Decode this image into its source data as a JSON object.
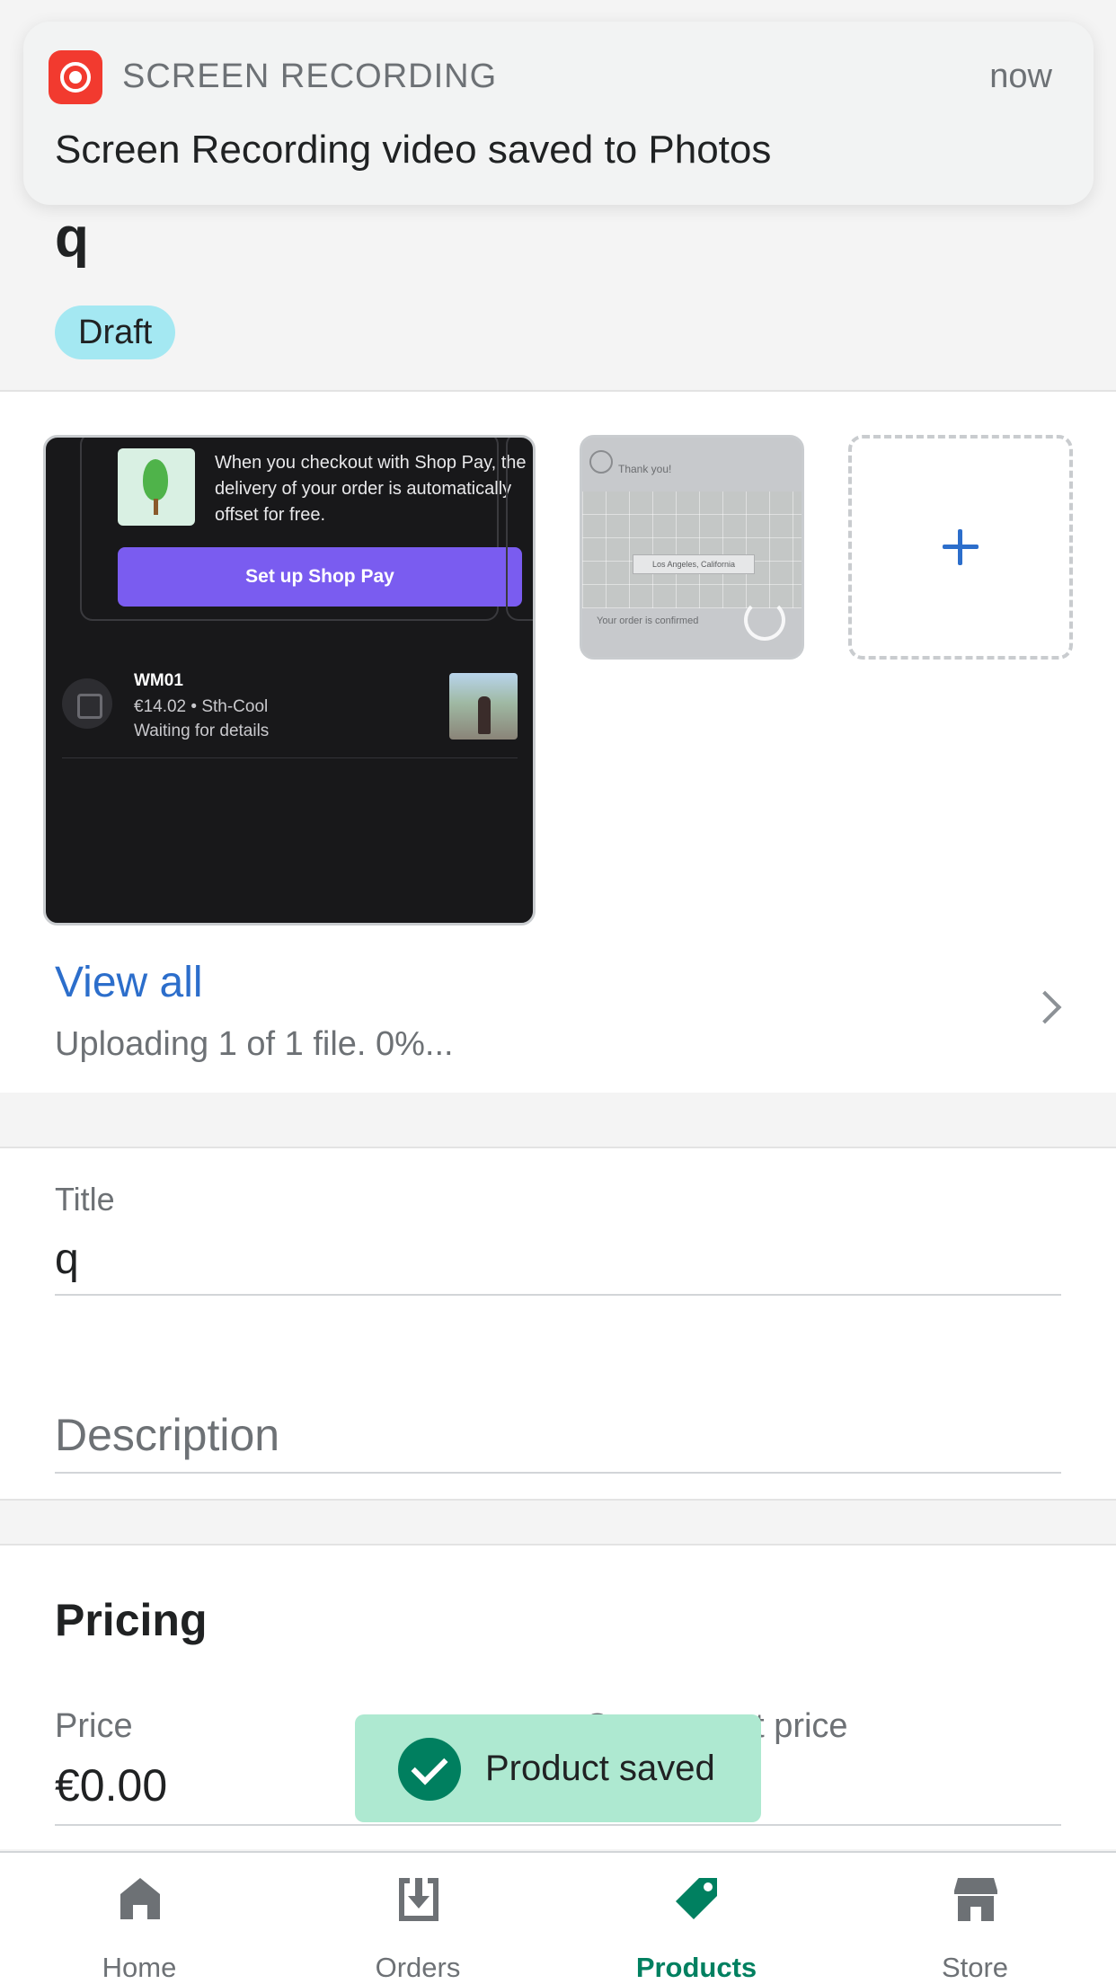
{
  "notification": {
    "app_name": "SCREEN RECORDING",
    "time": "now",
    "message": "Screen Recording video saved to Photos"
  },
  "product": {
    "name": "q",
    "status": "Draft"
  },
  "media": {
    "main_preview": {
      "promo_text": "When you checkout with Shop Pay, the delivery of your order is automatically offset for free.",
      "button_label": "Set up Shop Pay",
      "order_id": "WM01",
      "order_line1": "€14.02 • Sth-Cool",
      "order_line2": "Waiting for details"
    },
    "thumbnail": {
      "thanks": "Thank you!",
      "location": "Los Angeles, California",
      "confirmed": "Your order is confirmed"
    },
    "view_all": "View all",
    "upload_status": "Uploading 1 of 1 file. 0%..."
  },
  "form": {
    "title_label": "Title",
    "title_value": "q",
    "description_placeholder": "Description"
  },
  "pricing": {
    "heading": "Pricing",
    "price_label": "Price",
    "price_value": "€0.00",
    "compare_label": "Compare-at price"
  },
  "toast": {
    "message": "Product saved"
  },
  "tabs": [
    {
      "label": "Home",
      "icon": "home-icon"
    },
    {
      "label": "Orders",
      "icon": "orders-icon"
    },
    {
      "label": "Products",
      "icon": "tag-icon",
      "active": true
    },
    {
      "label": "Store",
      "icon": "store-icon"
    }
  ],
  "colors": {
    "accent_blue": "#2c6ecb",
    "active_green": "#008060",
    "badge_draft": "#a4e8f2",
    "toast_bg": "#aee9d1"
  }
}
